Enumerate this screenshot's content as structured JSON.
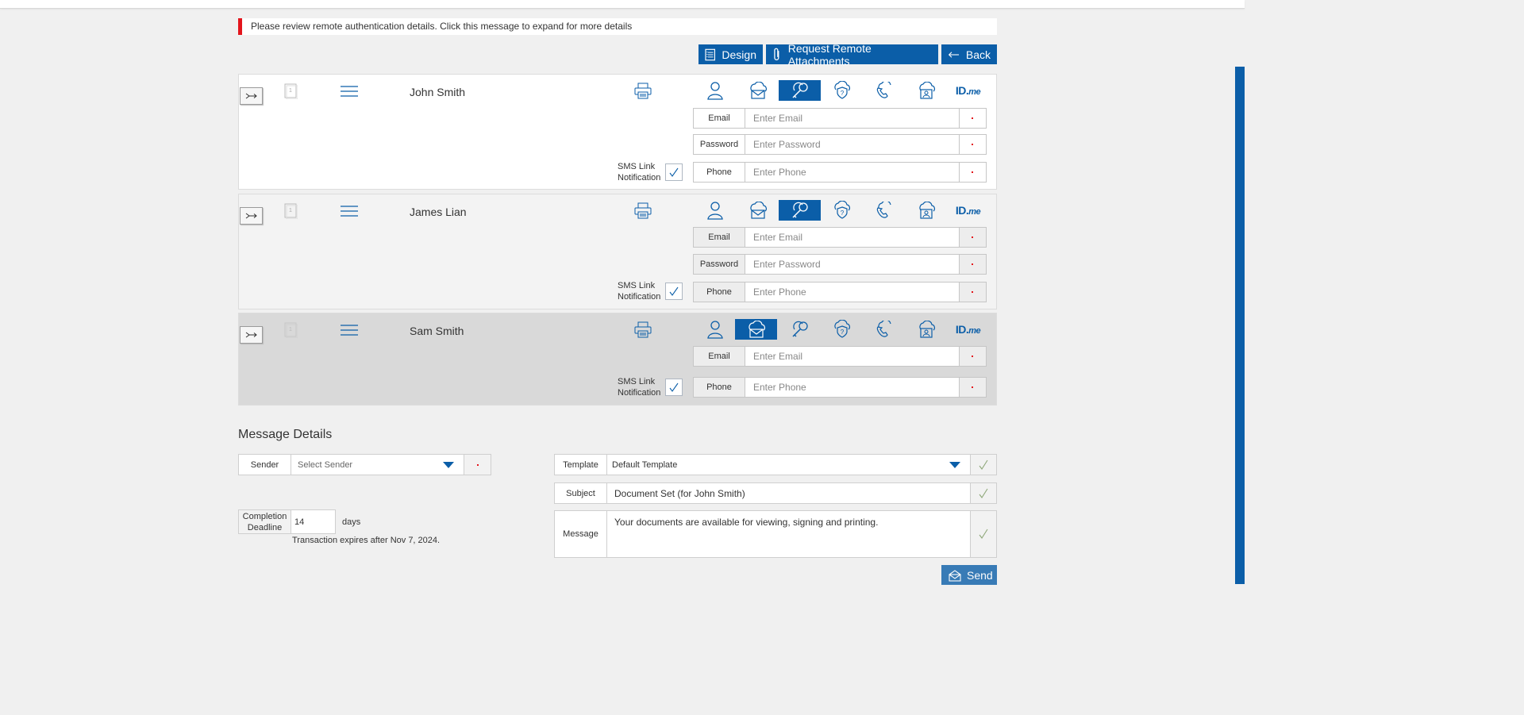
{
  "alert": {
    "text": "Please review remote authentication details. Click this message to expand for more details"
  },
  "toolbar": {
    "design_label": "Design",
    "request_label": "Request Remote Attachments",
    "back_label": "Back"
  },
  "recipients": [
    {
      "name": "John Smith",
      "active_method": "password",
      "fields": {
        "email_label": "Email",
        "email_placeholder": "Enter Email",
        "password_label": "Password",
        "password_placeholder": "Enter Password",
        "phone_label": "Phone",
        "phone_placeholder": "Enter Phone"
      },
      "sms_label": "SMS Link Notification"
    },
    {
      "name": "James Lian",
      "active_method": "password",
      "fields": {
        "email_label": "Email",
        "email_placeholder": "Enter Email",
        "password_label": "Password",
        "password_placeholder": "Enter Password",
        "phone_label": "Phone",
        "phone_placeholder": "Enter Phone"
      },
      "sms_label": "SMS Link Notification"
    },
    {
      "name": "Sam Smith",
      "active_method": "email",
      "fields": {
        "email_label": "Email",
        "email_placeholder": "Enter Email",
        "phone_label": "Phone",
        "phone_placeholder": "Enter Phone"
      },
      "sms_label": "SMS Link Notification"
    }
  ],
  "auth_methods": [
    "person-icon",
    "cloud-mail-icon",
    "key-icon",
    "shield-question-icon",
    "phone-icon",
    "cloud-id-icon",
    "idme-icon"
  ],
  "idme": {
    "id": "ID.",
    "me": "me"
  },
  "message_details": {
    "title": "Message Details",
    "sender_label": "Sender",
    "sender_placeholder": "Select Sender",
    "deadline_label": "Completion Deadline",
    "deadline_value": "14",
    "deadline_unit": "days",
    "expires_text": "Transaction expires after Nov 7, 2024.",
    "template_label": "Template",
    "template_value": "Default Template",
    "subject_label": "Subject",
    "subject_value": "Document Set (for John Smith)",
    "message_label": "Message",
    "message_value": "Your documents are available for viewing, signing and printing.",
    "send_label": "Send"
  },
  "colors": {
    "accent": "#0b5ea8",
    "alert": "#e3151c",
    "check": "#8fa87a"
  }
}
